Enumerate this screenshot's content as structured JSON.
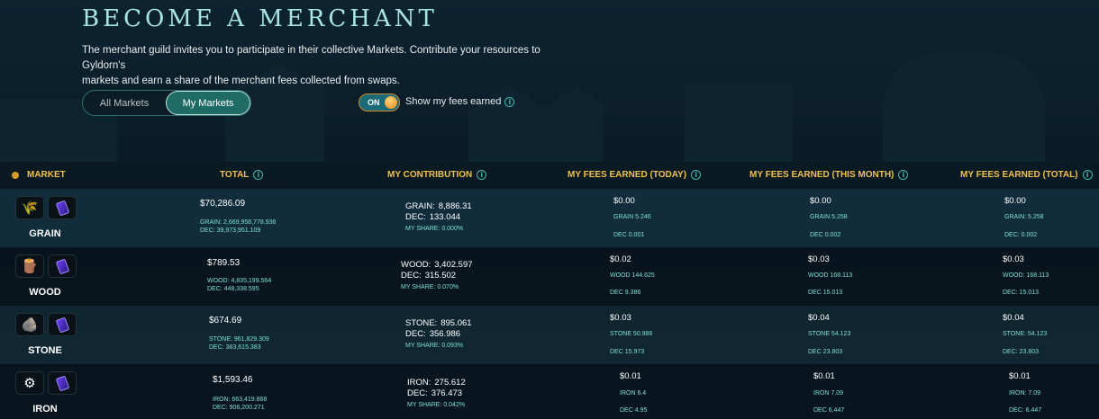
{
  "header": {
    "title": "BECOME A MERCHANT",
    "intro_line1": "The merchant guild invites you to participate in their collective Markets. Contribute your resources to Gyldorn's",
    "intro_line2": "markets and earn a share of the merchant fees collected from swaps."
  },
  "tabs": {
    "all": "All Markets",
    "mine": "My Markets",
    "active": "mine"
  },
  "toggle": {
    "state": "ON",
    "label": "Show my fees earned"
  },
  "columns": {
    "market": "MARKET",
    "total": "TOTAL",
    "contribution": "MY CONTRIBUTION",
    "today": "MY FEES EARNED (TODAY)",
    "month": "MY FEES EARNED (THIS MONTH)",
    "alltime": "MY FEES EARNED (TOTAL)"
  },
  "colors": {
    "accent_gold": "#f0c050",
    "teal": "#7fe0d6",
    "title": "#a9e5de"
  },
  "rows": [
    {
      "name": "GRAIN",
      "icon": "grain-icon",
      "total_usd": "$70,286.09",
      "total_res": "GRAIN: 2,669,958,778.936",
      "total_dec": "DEC: 39,973,951.109",
      "contrib_res_label": "GRAIN:",
      "contrib_res": "8,886.31",
      "contrib_dec_label": "DEC:",
      "contrib_dec": "133.044",
      "share": "MY SHARE: 0.000%",
      "today_usd": "$0.00",
      "today_res": "GRAIN 5.246",
      "today_dec": "DEC 0.001",
      "month_usd": "$0.00",
      "month_res": "GRAIN 5.258",
      "month_dec": "DEC 0.002",
      "total_fee_usd": "$0.00",
      "total_fee_res": "GRAIN: 5.258",
      "total_fee_dec": "DEC: 0.002"
    },
    {
      "name": "WOOD",
      "icon": "wood-icon",
      "total_usd": "$789.53",
      "total_res": "WOOD: 4,835,199.564",
      "total_dec": "DEC: 448,338.595",
      "contrib_res_label": "WOOD:",
      "contrib_res": "3,402.597",
      "contrib_dec_label": "DEC:",
      "contrib_dec": "315.502",
      "share": "MY SHARE: 0.070%",
      "today_usd": "$0.02",
      "today_res": "WOOD 144.625",
      "today_dec": "DEC 9.386",
      "month_usd": "$0.03",
      "month_res": "WOOD 168.113",
      "month_dec": "DEC 15.013",
      "total_fee_usd": "$0.03",
      "total_fee_res": "WOOD: 168.113",
      "total_fee_dec": "DEC: 15.013"
    },
    {
      "name": "STONE",
      "icon": "stone-icon",
      "total_usd": "$674.69",
      "total_res": "STONE: 961,829.309",
      "total_dec": "DEC: 383,615.383",
      "contrib_res_label": "STONE:",
      "contrib_res": "895.061",
      "contrib_dec_label": "DEC:",
      "contrib_dec": "356.986",
      "share": "MY SHARE: 0.093%",
      "today_usd": "$0.03",
      "today_res": "STONE 50.986",
      "today_dec": "DEC 15.973",
      "month_usd": "$0.04",
      "month_res": "STONE 54.123",
      "month_dec": "DEC 23.803",
      "total_fee_usd": "$0.04",
      "total_fee_res": "STONE: 54.123",
      "total_fee_dec": "DEC: 23.803"
    },
    {
      "name": "IRON",
      "icon": "iron-icon",
      "total_usd": "$1,593.46",
      "total_res": "IRON: 663,419.868",
      "total_dec": "DEC: 906,200.271",
      "contrib_res_label": "IRON:",
      "contrib_res": "275.612",
      "contrib_dec_label": "DEC:",
      "contrib_dec": "376.473",
      "share": "MY SHARE: 0.042%",
      "today_usd": "$0.01",
      "today_res": "IRON 6.4",
      "today_dec": "DEC 4.95",
      "month_usd": "$0.01",
      "month_res": "IRON 7.09",
      "month_dec": "DEC 6.447",
      "total_fee_usd": "$0.01",
      "total_fee_res": "IRON: 7.09",
      "total_fee_dec": "DEC: 6.447"
    }
  ]
}
